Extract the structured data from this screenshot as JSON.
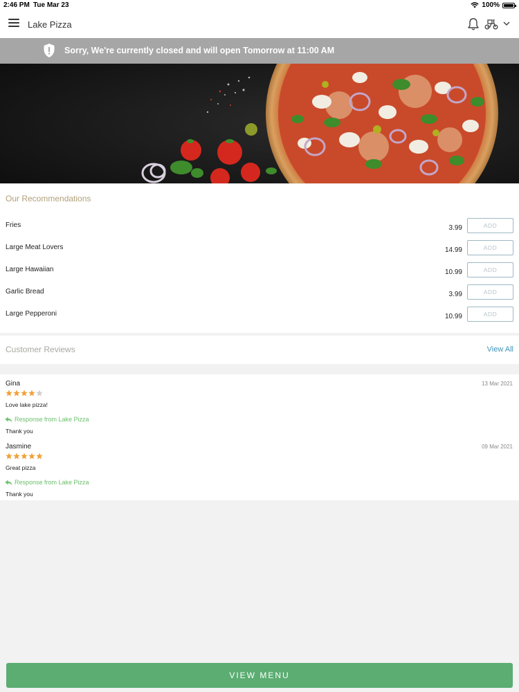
{
  "status_bar": {
    "time": "2:46 PM",
    "date": "Tue Mar 23",
    "battery": "100%",
    "icons": [
      "wifi-icon",
      "battery-icon"
    ]
  },
  "header": {
    "title": "Lake Pizza",
    "icons": [
      "menu-icon",
      "bell-icon",
      "scooter-icon",
      "chevron-down-icon"
    ]
  },
  "banner": {
    "message": "Sorry, We're currently closed and will open Tomorrow at 11:00 AM",
    "icon": "shield-alert-icon",
    "background": "#a6a6a6"
  },
  "recommendations": {
    "title": "Our Recommendations",
    "add_label": "ADD",
    "items": [
      {
        "name": "Fries",
        "price": "3.99"
      },
      {
        "name": "Large Meat Lovers",
        "price": "14.99"
      },
      {
        "name": "Large Hawaiian",
        "price": "10.99"
      },
      {
        "name": "Garlic Bread",
        "price": "3.99"
      },
      {
        "name": "Large Pepperoni",
        "price": "10.99"
      }
    ]
  },
  "reviews": {
    "title": "Customer Reviews",
    "view_all": "View All",
    "items": [
      {
        "name": "Gina",
        "date": "13 Mar 2021",
        "rating": 4,
        "text": "Love lake pizza!",
        "response_label": "Response from Lake Pizza",
        "response": "Thank you"
      },
      {
        "name": "Jasmine",
        "date": "09 Mar 2021",
        "rating": 5,
        "text": "Great pizza",
        "response_label": "Response from Lake Pizza",
        "response": "Thank you"
      }
    ]
  },
  "footer": {
    "view_menu": "VIEW MENU"
  },
  "colors": {
    "accent_green": "#5bad72",
    "link_blue": "#3d94b8",
    "star": "#f0a23a",
    "response_green": "#6cbf6a"
  }
}
